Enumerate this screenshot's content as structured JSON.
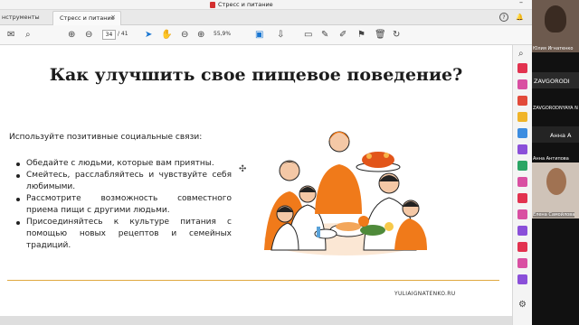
{
  "window": {
    "title": "Стресс и питание",
    "minimize": "–"
  },
  "tabs": {
    "tools": "нструменты",
    "doc": "Стресс и питание",
    "close": "×"
  },
  "toolbar": {
    "page_current": "34",
    "page_total": "/ 41",
    "zoom": "55,9%"
  },
  "slide": {
    "title": "Как улучшить свое пищевое поведение?",
    "intro": "Используйте позитивные социальные связи:",
    "bullets": [
      "Обедайте с людьми, которые вам приятны.",
      "Смейтесь, расслабляйтесь и чувствуйте себя любимыми.",
      "Рассмотрите возможность совместного приема пищи с другими людьми.",
      "Присоединяйтесь к культуре питания с помощью новых рецептов и семейных традиций."
    ],
    "footer_site": "YULIAIGNATENKO.RU"
  },
  "participants": [
    {
      "name": "Юлия Игнатенко",
      "display": ""
    },
    {
      "name": "",
      "display": "ZAVGORODI"
    },
    {
      "name": "ZAVGORODNYAYA N",
      "display": ""
    },
    {
      "name": "",
      "display": "Анна А"
    },
    {
      "name": "Анна Антипова",
      "display": ""
    },
    {
      "name": "Елена Самойлова",
      "display": ""
    }
  ],
  "colors": {
    "accent": "#1976d2",
    "footer_line": "#e0a840",
    "pdf_red": "#d32f2f",
    "illustration_orange": "#f07a1a"
  }
}
